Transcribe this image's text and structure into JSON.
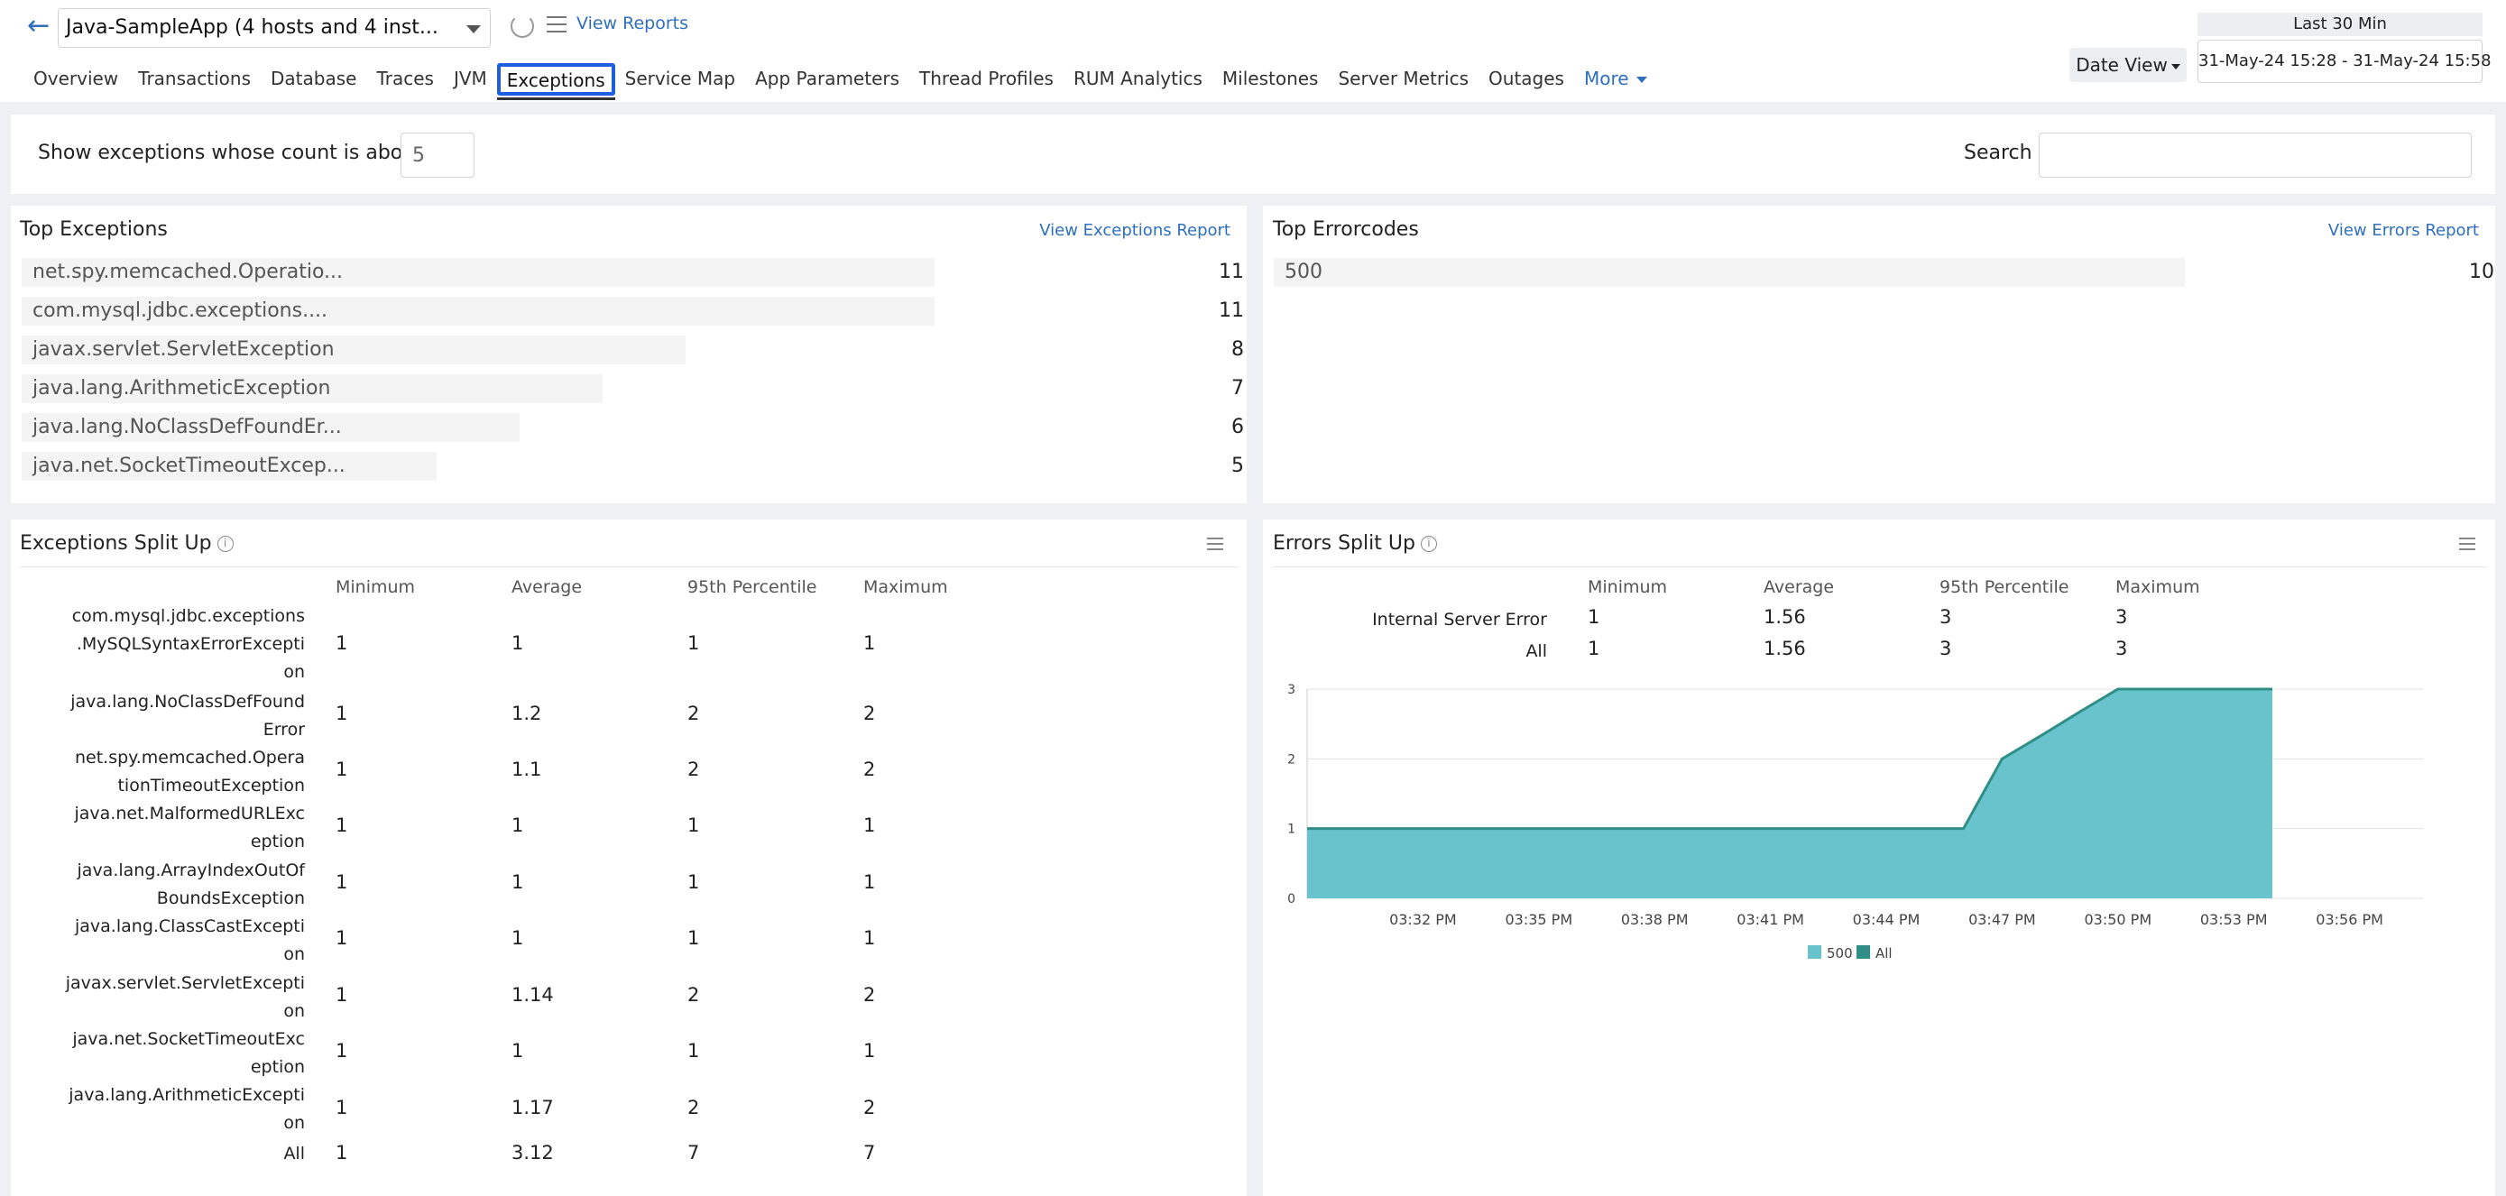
{
  "header": {
    "app_name": "Java-SampleApp (4 hosts and 4 inst...",
    "view_reports": "View Reports",
    "tabs": [
      "Overview",
      "Transactions",
      "Database",
      "Traces",
      "JVM",
      "Exceptions",
      "Service Map",
      "App Parameters",
      "Thread Profiles",
      "RUM Analytics",
      "Milestones",
      "Server Metrics",
      "Outages"
    ],
    "more_label": "More",
    "date_view": "Date View",
    "range_label": "Last 30 Min",
    "range_value": "31-May-24 15:28 - 31-May-24 15:58"
  },
  "filter": {
    "label": "Show exceptions whose count is above",
    "count_value": "5",
    "search_label": "Search"
  },
  "top_exceptions": {
    "title": "Top Exceptions",
    "link": "View Exceptions Report",
    "rows": [
      {
        "label": "net.spy.memcached.Operatio...",
        "count": "11"
      },
      {
        "label": "com.mysql.jdbc.exceptions....",
        "count": "11"
      },
      {
        "label": "javax.servlet.ServletException",
        "count": "8"
      },
      {
        "label": "java.lang.ArithmeticException",
        "count": "7"
      },
      {
        "label": "java.lang.NoClassDefFoundEr...",
        "count": "6"
      },
      {
        "label": "java.net.SocketTimeoutExcep...",
        "count": "5"
      }
    ]
  },
  "top_errorcodes": {
    "title": "Top Errorcodes",
    "link": "View Errors Report",
    "rows": [
      {
        "label": "500",
        "count": "10"
      }
    ]
  },
  "exceptions_split": {
    "title": "Exceptions Split Up",
    "columns": [
      "Minimum",
      "Average",
      "95th Percentile",
      "Maximum"
    ],
    "rows": [
      {
        "name": "com.mysql.jdbc.exceptions\n.MySQLSyntaxErrorExcepti\non",
        "min": "1",
        "avg": "1",
        "p95": "1",
        "max": "1"
      },
      {
        "name": "java.lang.NoClassDefFound\nError",
        "min": "1",
        "avg": "1.2",
        "p95": "2",
        "max": "2"
      },
      {
        "name": "net.spy.memcached.Opera\ntionTimeoutException",
        "min": "1",
        "avg": "1.1",
        "p95": "2",
        "max": "2"
      },
      {
        "name": "java.net.MalformedURLExc\neption",
        "min": "1",
        "avg": "1",
        "p95": "1",
        "max": "1"
      },
      {
        "name": "java.lang.ArrayIndexOutOf\nBoundsException",
        "min": "1",
        "avg": "1",
        "p95": "1",
        "max": "1"
      },
      {
        "name": "java.lang.ClassCastExcepti\non",
        "min": "1",
        "avg": "1",
        "p95": "1",
        "max": "1"
      },
      {
        "name": "javax.servlet.ServletExcepti\non",
        "min": "1",
        "avg": "1.14",
        "p95": "2",
        "max": "2"
      },
      {
        "name": "java.net.SocketTimeoutExc\neption",
        "min": "1",
        "avg": "1",
        "p95": "1",
        "max": "1"
      },
      {
        "name": "java.lang.ArithmeticExcepti\non",
        "min": "1",
        "avg": "1.17",
        "p95": "2",
        "max": "2"
      },
      {
        "name": "All",
        "min": "1",
        "avg": "3.12",
        "p95": "7",
        "max": "7"
      }
    ]
  },
  "errors_split": {
    "title": "Errors Split Up",
    "columns": [
      "Minimum",
      "Average",
      "95th Percentile",
      "Maximum"
    ],
    "rows": [
      {
        "name": "Internal Server Error",
        "min": "1",
        "avg": "1.56",
        "p95": "3",
        "max": "3"
      },
      {
        "name": "All",
        "min": "1",
        "avg": "1.56",
        "p95": "3",
        "max": "3"
      }
    ]
  },
  "chart_data": {
    "type": "area",
    "x": [
      "03:29 PM",
      "03:30 PM",
      "03:31 PM",
      "03:32 PM",
      "03:33 PM",
      "03:34 PM",
      "03:35 PM",
      "03:36 PM",
      "03:37 PM",
      "03:38 PM",
      "03:39 PM",
      "03:40 PM",
      "03:41 PM",
      "03:42 PM",
      "03:43 PM",
      "03:44 PM",
      "03:45 PM",
      "03:46 PM",
      "03:47 PM",
      "03:48 PM",
      "03:49 PM",
      "03:50 PM",
      "03:51 PM",
      "03:52 PM",
      "03:53 PM",
      "03:54 PM"
    ],
    "x_ticks": [
      "03:32 PM",
      "03:35 PM",
      "03:38 PM",
      "03:41 PM",
      "03:44 PM",
      "03:47 PM",
      "03:50 PM",
      "03:53 PM",
      "03:56 PM"
    ],
    "y_ticks": [
      "0",
      "1",
      "2",
      "3"
    ],
    "ylim": [
      0,
      3
    ],
    "series": [
      {
        "name": "500",
        "color": "#68c3cc",
        "values": [
          1,
          1,
          1,
          1,
          1,
          1,
          1,
          1,
          1,
          1,
          1,
          1,
          1,
          1,
          1,
          1,
          1,
          1,
          2,
          2.33,
          2.67,
          3,
          3,
          3,
          3,
          3
        ]
      },
      {
        "name": "All",
        "color": "#2f8f86",
        "values": [
          1,
          1,
          1,
          1,
          1,
          1,
          1,
          1,
          1,
          1,
          1,
          1,
          1,
          1,
          1,
          1,
          1,
          1,
          2,
          2.33,
          2.67,
          3,
          3,
          3,
          3,
          3
        ]
      }
    ],
    "legend": "bottom-center",
    "grid": true
  }
}
